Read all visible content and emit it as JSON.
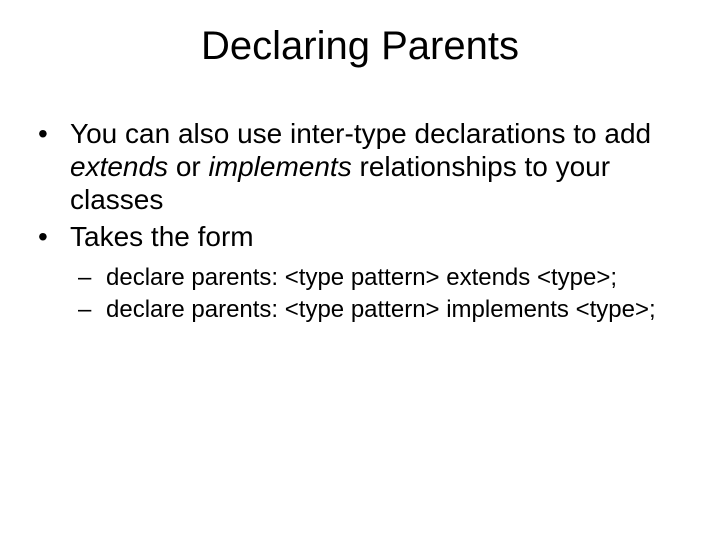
{
  "title": "Declaring Parents",
  "bullets": {
    "b1_pre": "You can also use inter-type declarations to add ",
    "b1_ext": "extends",
    "b1_mid": " or ",
    "b1_impl": "implements",
    "b1_post": " relationships to your classes",
    "b2": "Takes the form",
    "sub1": "declare parents: <type pattern> extends <type>;",
    "sub2": "declare parents: <type pattern> implements <type>;"
  }
}
